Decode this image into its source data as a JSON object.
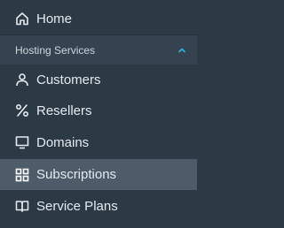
{
  "nav": {
    "home_label": "Home",
    "section_label": "Hosting Services",
    "customers_label": "Customers",
    "resellers_label": "Resellers",
    "domains_label": "Domains",
    "subscriptions_label": "Subscriptions",
    "service_plans_label": "Service Plans",
    "selected_item": "Subscriptions"
  },
  "colors": {
    "sidebar_bg": "#2c3a45",
    "section_bg": "#34434f",
    "selected_bg": "#4d5c68",
    "text": "#e4eaef",
    "chevron_accent": "#31b2e8"
  },
  "icons": {
    "home": "home-icon",
    "customers": "user-icon",
    "resellers": "percent-icon",
    "domains": "monitor-icon",
    "subscriptions": "grid-icon",
    "service_plans": "book-icon",
    "section": "chevron-up-icon"
  }
}
